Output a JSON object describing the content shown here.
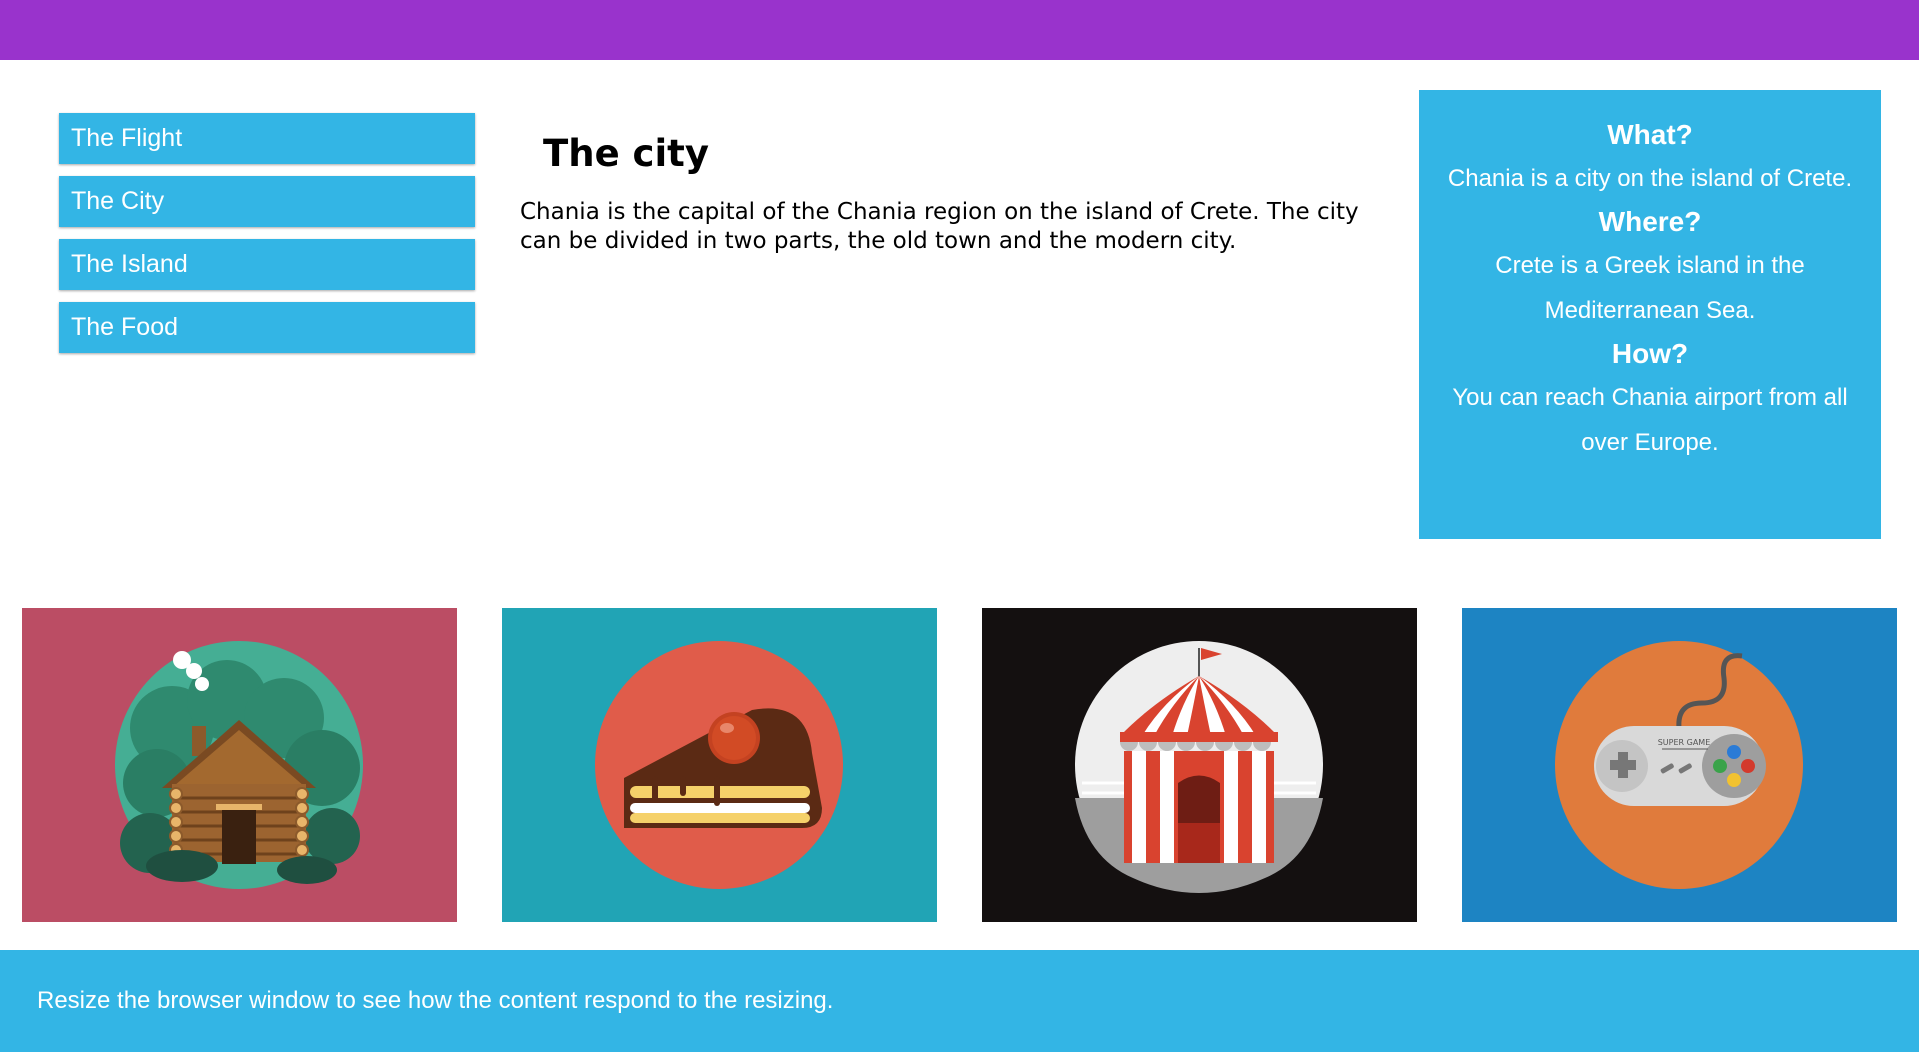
{
  "colors": {
    "header": "#9933cc",
    "accent": "#33b5e5",
    "tile_cabin_bg": "#bb4d64",
    "tile_cake_bg": "#21a4b5",
    "tile_circus_bg": "#141010",
    "tile_gamepad_bg": "#1d84c3"
  },
  "menu": {
    "items": [
      {
        "label": "The Flight"
      },
      {
        "label": "The City"
      },
      {
        "label": "The Island"
      },
      {
        "label": "The Food"
      }
    ]
  },
  "main": {
    "title": "The city",
    "text": "Chania is the capital of the Chania region on the island of Crete. The city can be divided in two parts, the old town and the modern city."
  },
  "aside": {
    "what_heading": "What?",
    "what_text": "Chania is a city on the island of Crete.",
    "where_heading": "Where?",
    "where_text": "Crete is a Greek island in the Mediterranean Sea.",
    "how_heading": "How?",
    "how_text": "You can reach Chania airport from all over Europe."
  },
  "gallery": {
    "tiles": [
      {
        "icon": "log-cabin-icon"
      },
      {
        "icon": "cake-slice-icon",
        "logo_text": ""
      },
      {
        "icon": "circus-tent-icon"
      },
      {
        "icon": "gamepad-icon",
        "logo_text": "SUPER GAME"
      }
    ]
  },
  "footer": {
    "text": "Resize the browser window to see how the content respond to the resizing."
  }
}
